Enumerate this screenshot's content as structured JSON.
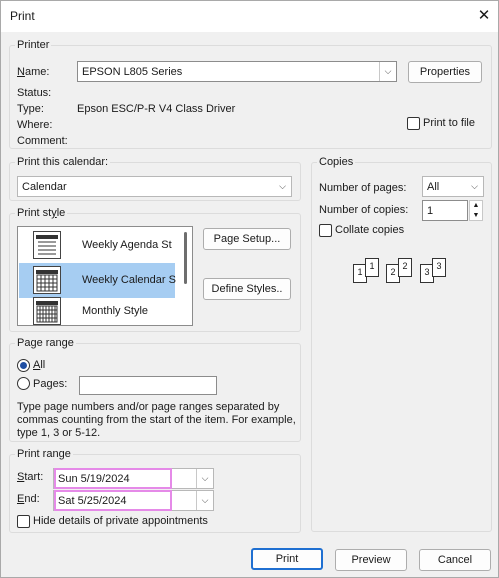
{
  "window": {
    "title": "Print",
    "close_glyph": "✕"
  },
  "printer": {
    "group_title": "Printer",
    "name_label": "Name:",
    "name_value": "EPSON L805 Series",
    "properties_button": "Properties",
    "status_label": "Status:",
    "type_label": "Type:",
    "type_value": "Epson ESC/P-R V4 Class Driver",
    "where_label": "Where:",
    "comment_label": "Comment:",
    "print_to_file_label": "Print to file",
    "print_to_file_checked": false
  },
  "print_calendar": {
    "group_title": "Print this calendar:",
    "value": "Calendar"
  },
  "print_style": {
    "group_title": "Print style",
    "items": [
      {
        "label": "Weekly Agenda St",
        "selected": false,
        "icon": "weekly-agenda-icon"
      },
      {
        "label": "Weekly Calendar S",
        "selected": true,
        "icon": "weekly-calendar-icon"
      },
      {
        "label": "Monthly Style",
        "selected": false,
        "icon": "monthly-style-icon"
      }
    ],
    "page_setup_button": "Page Setup...",
    "define_styles_button": "Define Styles.."
  },
  "copies": {
    "group_title": "Copies",
    "num_pages_label": "Number of pages:",
    "num_pages_value": "All",
    "num_copies_label": "Number of copies:",
    "num_copies_value": "1",
    "collate_label": "Collate copies",
    "collate_checked": false,
    "collate_pages": [
      "1",
      "1",
      "2",
      "2",
      "3",
      "3"
    ]
  },
  "page_range": {
    "group_title": "Page range",
    "all_label": "All",
    "pages_label": "Pages:",
    "pages_value": "",
    "hint": "Type page numbers and/or page ranges separated by commas counting from the start of the item.  For example, type 1, 3 or 5-12."
  },
  "print_range": {
    "group_title": "Print range",
    "start_label": "Start:",
    "start_value": "Sun 5/19/2024",
    "end_label": "End:",
    "end_value": "Sat 5/25/2024",
    "hide_details_label": "Hide details of private appointments",
    "hide_details_checked": false
  },
  "footer": {
    "print_button": "Print",
    "preview_button": "Preview",
    "cancel_button": "Cancel"
  },
  "colors": {
    "accent": "#1f6fd1",
    "selection": "#a6cdf2",
    "highlight_border": "#e58ae8"
  }
}
